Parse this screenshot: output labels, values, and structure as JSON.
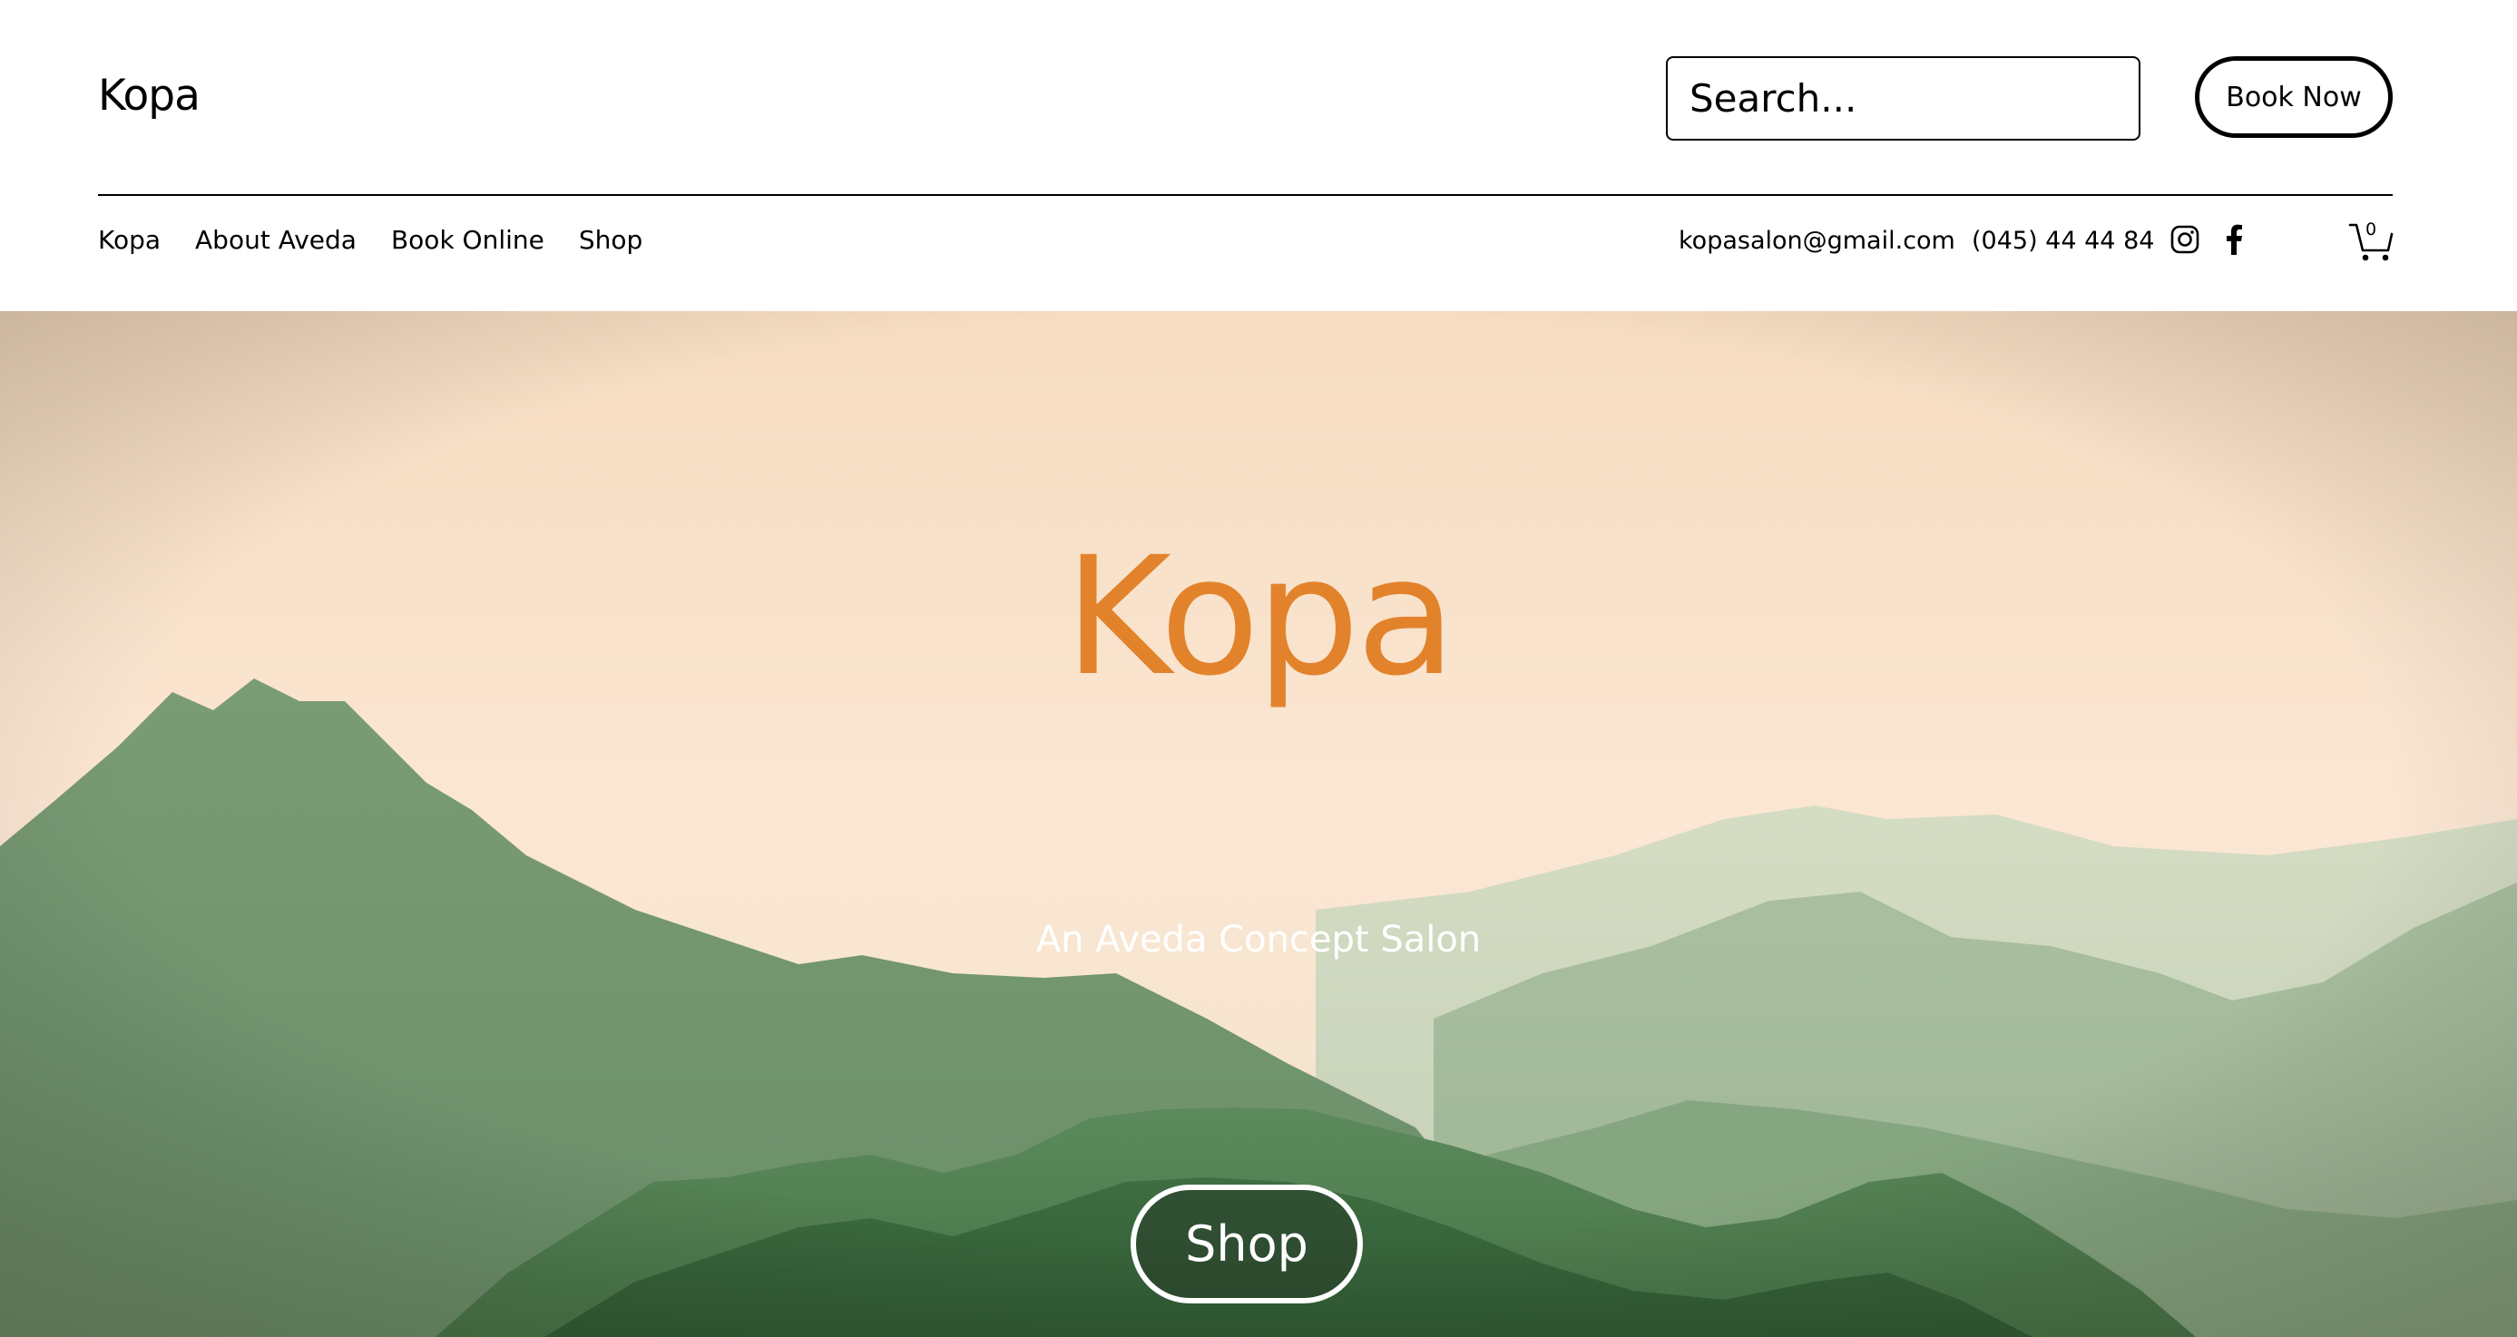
{
  "header": {
    "logo": "Kopa",
    "search": {
      "placeholder": "Search..."
    },
    "book_button": "Book Now"
  },
  "nav": {
    "items": [
      {
        "label": "Kopa"
      },
      {
        "label": "About Aveda"
      },
      {
        "label": "Book Online"
      },
      {
        "label": "Shop"
      }
    ]
  },
  "contact": {
    "email": "kopasalon@gmail.com",
    "phone": "(045) 44 44 84",
    "social": [
      "instagram-icon",
      "facebook-icon"
    ]
  },
  "cart": {
    "count": "0"
  },
  "hero": {
    "title": "Kopa",
    "subtitle": "An Aveda Concept Salon",
    "button": "Shop",
    "colors": {
      "title": "#e2832c",
      "sky": "#fbe6d2",
      "mountains": "#5f8a60"
    }
  }
}
